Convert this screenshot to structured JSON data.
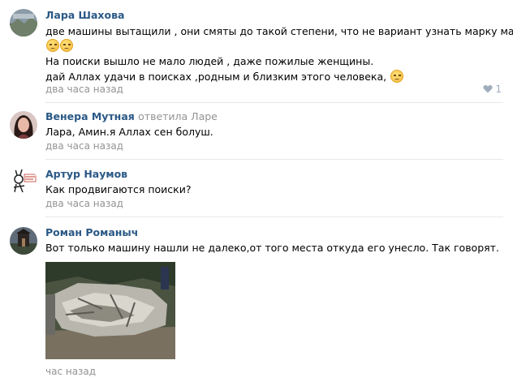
{
  "comments": [
    {
      "author": "Лара Шахова",
      "lines": [
        "две машины вытащили , они смяты до такой степени, что не вариант узнать марку машин",
        "На поиски вышло не мало людей , даже пожилые женщины.",
        "дай Аллах удачи в поисках ,родным и близким этого человека,"
      ],
      "emoji": [
        "sad-face-emoji",
        "sad-face-emoji",
        "relieved-face-emoji"
      ],
      "time": "два часа назад",
      "likes": "1"
    },
    {
      "author": "Венера Мутная",
      "reply_text": "ответила Ларе",
      "lines": [
        "Лара, Амин.я Аллах сен болуш."
      ],
      "time": "два часа назад"
    },
    {
      "author": "Артур Наумов",
      "lines": [
        "Как продвигаются поиски?"
      ],
      "time": "два часа назад"
    },
    {
      "author": "Роман Романыч",
      "lines": [
        "Вот только машину нашли не далеко,от того места откуда его унесло. Так говорят."
      ],
      "time": "час назад"
    }
  ],
  "colors": {
    "author": "#2a5885",
    "meta": "#939393",
    "divider": "#e7e8ec",
    "like": "#a0adbd"
  },
  "icons": {
    "like": "heart-icon"
  }
}
